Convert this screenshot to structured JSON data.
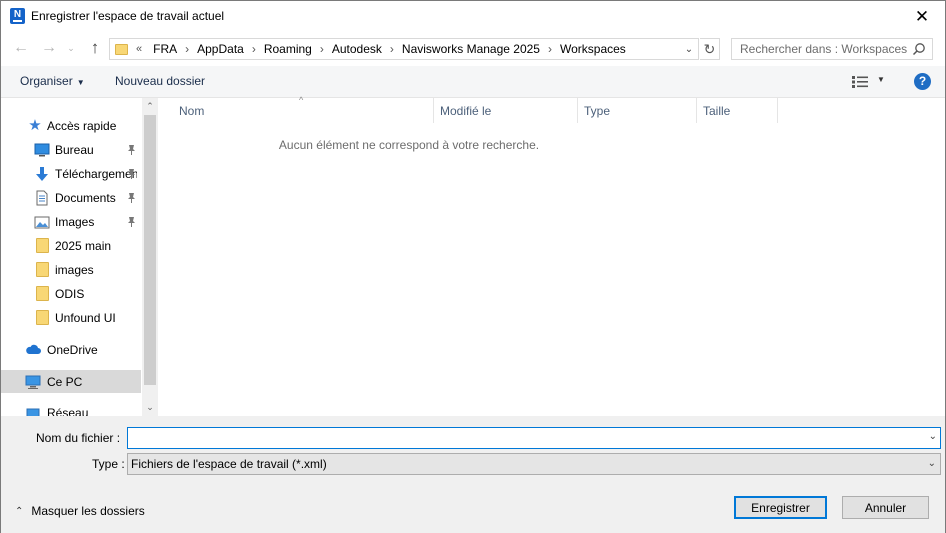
{
  "window": {
    "title": "Enregistrer l'espace de travail actuel",
    "app_icon_letter": "N",
    "close_glyph": "✕"
  },
  "nav": {
    "back_glyph": "←",
    "forward_glyph": "→",
    "recent_glyph": "⌄",
    "up_glyph": "↑",
    "overflow": "«",
    "breadcrumbs": [
      {
        "label": "FRA"
      },
      {
        "label": "AppData"
      },
      {
        "label": "Roaming"
      },
      {
        "label": "Autodesk"
      },
      {
        "label": "Navisworks Manage 2025"
      },
      {
        "label": "Workspaces"
      }
    ],
    "breadcrumb_sep": "›",
    "refresh_glyph": "↻",
    "dropdown_glyph": "⌄",
    "search_placeholder": "Rechercher dans : Workspaces"
  },
  "toolbar": {
    "organiser_label": "Organiser",
    "organiser_caret": "▼",
    "new_folder_label": "Nouveau dossier",
    "view_caret": "▼",
    "help_glyph": "?"
  },
  "sidebar": {
    "items": [
      {
        "label": "Accès rapide",
        "icon": "star-icon"
      },
      {
        "label": "Bureau",
        "icon": "desktop-icon",
        "pinned": true
      },
      {
        "label": "Téléchargements",
        "icon": "download-icon",
        "pinned": true
      },
      {
        "label": "Documents",
        "icon": "documents-icon",
        "pinned": true
      },
      {
        "label": "Images",
        "icon": "pictures-icon",
        "pinned": true
      },
      {
        "label": "2025 main",
        "icon": "folder-icon"
      },
      {
        "label": "images",
        "icon": "folder-icon"
      },
      {
        "label": "ODIS",
        "icon": "folder-icon"
      },
      {
        "label": "Unfound UI",
        "icon": "folder-icon"
      },
      {
        "label": "OneDrive",
        "icon": "cloud-icon"
      },
      {
        "label": "Ce PC",
        "icon": "computer-icon",
        "selected": true
      },
      {
        "label": "Réseau",
        "icon": "network-icon"
      }
    ],
    "scroll_up": "⌃",
    "scroll_down": "⌄"
  },
  "filelist": {
    "columns": [
      "Nom",
      "Modifié le",
      "Type",
      "Taille"
    ],
    "sort_glyph": "^",
    "empty_message": "Aucun élément ne correspond à votre recherche."
  },
  "footer": {
    "filename_label": "Nom du fichier :",
    "filename_value": "",
    "type_label": "Type :",
    "type_value": "Fichiers de l'espace de travail (*.xml)",
    "hide_folders_label": "Masquer les dossiers",
    "hide_folders_glyph": "⌃",
    "save_label": "Enregistrer",
    "cancel_label": "Annuler"
  },
  "colors": {
    "accent": "#0078d7",
    "help": "#1f6dc4",
    "selected_bg": "#d9d9d9",
    "folder": "#f8d775"
  }
}
